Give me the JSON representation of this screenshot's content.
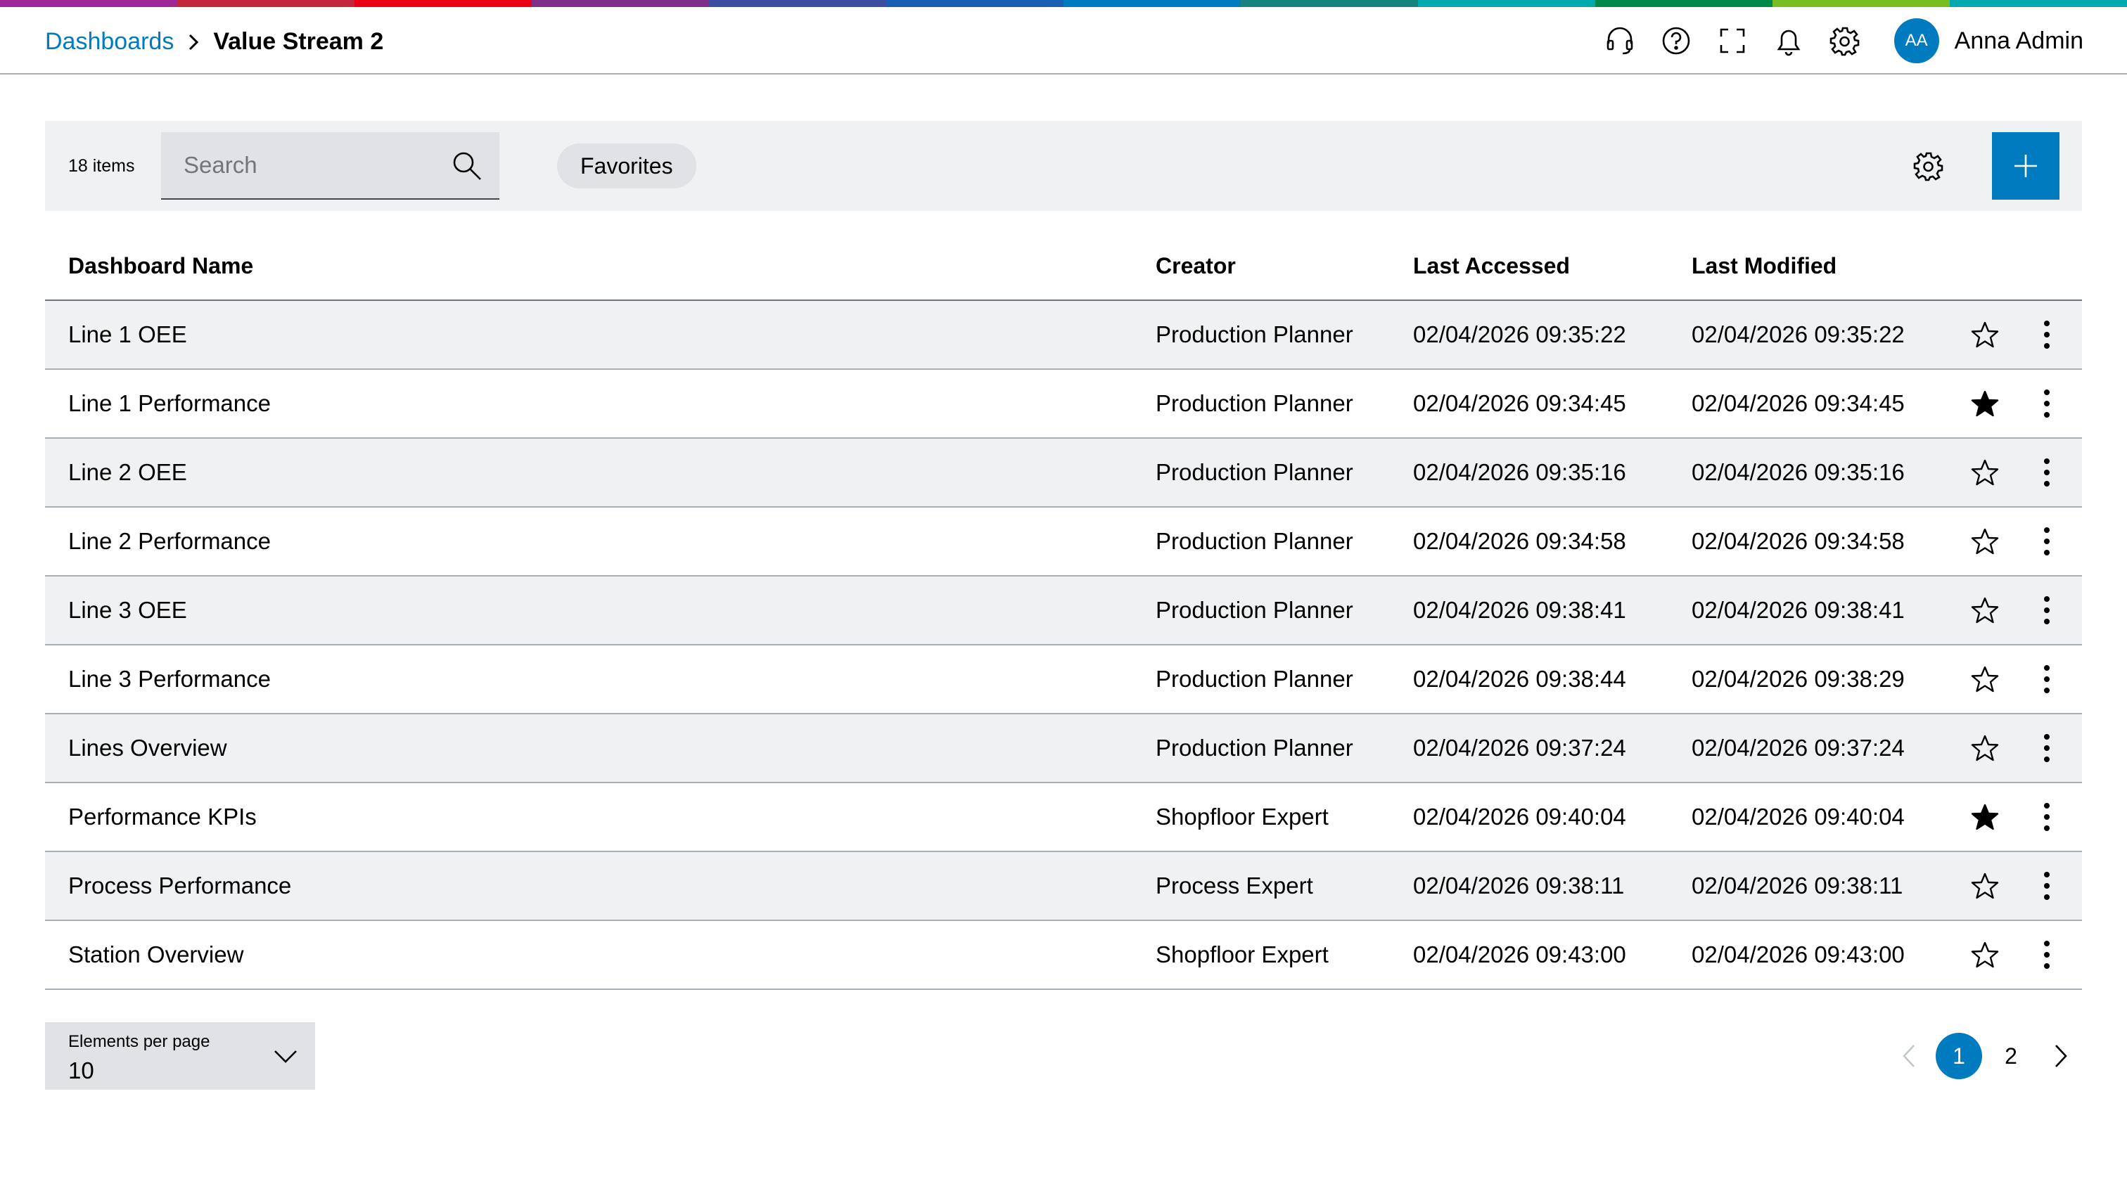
{
  "colors": {
    "accent": "#007bc0",
    "rainbow": [
      "#9e2896",
      "#c4273c",
      "#ea0016",
      "#7d2f8a",
      "#3b4ea0",
      "#1a5fb4",
      "#007bc0",
      "#18837e",
      "#00a8b0",
      "#00884a",
      "#78be20",
      "#00a8b0"
    ]
  },
  "breadcrumb": {
    "parent": "Dashboards",
    "separator_icon": "chevron-right-icon",
    "current": "Value Stream 2"
  },
  "header": {
    "icons": [
      "headset-icon",
      "help-icon",
      "fullscreen-icon",
      "bell-icon",
      "gear-icon"
    ],
    "user_initials": "AA",
    "user_name": "Anna Admin"
  },
  "toolbar": {
    "items_count": "18 items",
    "search_placeholder": "Search",
    "search_value": "",
    "favorites_label": "Favorites",
    "settings_icon": "gear-icon",
    "add_icon": "plus-icon"
  },
  "table": {
    "columns": [
      "Dashboard Name",
      "Creator",
      "Last Accessed",
      "Last Modified"
    ],
    "rows": [
      {
        "name": "Line 1 OEE",
        "creator": "Production Planner",
        "last_accessed": "02/04/2026 09:35:22",
        "last_modified": "02/04/2026 09:35:22",
        "favorite": false
      },
      {
        "name": "Line 1 Performance",
        "creator": "Production Planner",
        "last_accessed": "02/04/2026 09:34:45",
        "last_modified": "02/04/2026 09:34:45",
        "favorite": true
      },
      {
        "name": "Line 2 OEE",
        "creator": "Production Planner",
        "last_accessed": "02/04/2026 09:35:16",
        "last_modified": "02/04/2026 09:35:16",
        "favorite": false
      },
      {
        "name": "Line 2 Performance",
        "creator": "Production Planner",
        "last_accessed": "02/04/2026 09:34:58",
        "last_modified": "02/04/2026 09:34:58",
        "favorite": false
      },
      {
        "name": "Line 3 OEE",
        "creator": "Production Planner",
        "last_accessed": "02/04/2026 09:38:41",
        "last_modified": "02/04/2026 09:38:41",
        "favorite": false
      },
      {
        "name": "Line 3 Performance",
        "creator": "Production Planner",
        "last_accessed": "02/04/2026 09:38:44",
        "last_modified": "02/04/2026 09:38:29",
        "favorite": false
      },
      {
        "name": "Lines Overview",
        "creator": "Production Planner",
        "last_accessed": "02/04/2026 09:37:24",
        "last_modified": "02/04/2026 09:37:24",
        "favorite": false
      },
      {
        "name": "Performance KPIs",
        "creator": "Shopfloor Expert",
        "last_accessed": "02/04/2026 09:40:04",
        "last_modified": "02/04/2026 09:40:04",
        "favorite": true
      },
      {
        "name": "Process Performance",
        "creator": "Process Expert",
        "last_accessed": "02/04/2026 09:38:11",
        "last_modified": "02/04/2026 09:38:11",
        "favorite": false
      },
      {
        "name": "Station Overview",
        "creator": "Shopfloor Expert",
        "last_accessed": "02/04/2026 09:43:00",
        "last_modified": "02/04/2026 09:43:00",
        "favorite": false
      }
    ]
  },
  "footer": {
    "per_page_label": "Elements per page",
    "per_page_value": "10",
    "pages": [
      "1",
      "2"
    ],
    "current_page": "1"
  }
}
